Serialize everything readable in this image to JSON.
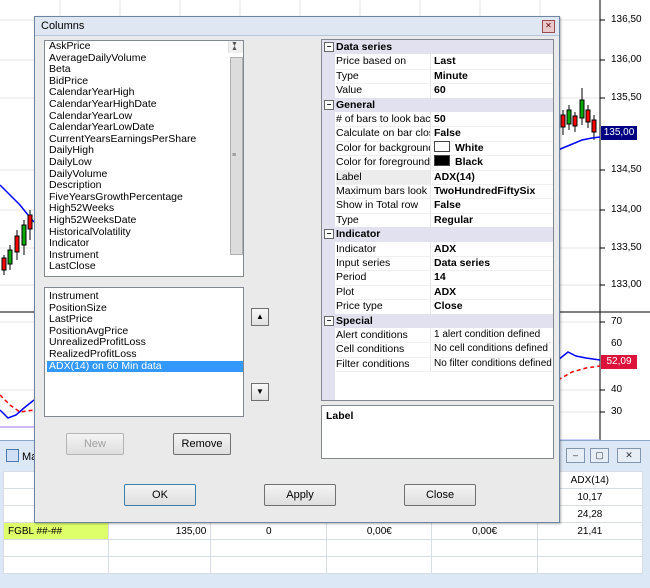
{
  "chart": {
    "y_axis_labels": [
      "136,50",
      "136,00",
      "135,50",
      "134,50",
      "134,00",
      "133,50",
      "133,00",
      "70",
      "60",
      "40",
      "30"
    ],
    "price_tag_main": "135,00",
    "price_tag_indicator": "52,09",
    "price_tag_main_color": "#000080",
    "price_tag_indicator_color": "#dc143c",
    "line_color": "#0000ff",
    "dash_color": "#ff0000"
  },
  "market_window": {
    "title": "Ma",
    "columns_partial": [
      "In",
      "ADX(14)"
    ],
    "rows": [
      {
        "instrument": "E",
        "adx": "10,17"
      },
      {
        "instrument": "FE",
        "adx": "24,28"
      },
      {
        "instrument": "FGBL ##-##",
        "price": "135,00",
        "position": "0",
        "pnl1": "0,00€",
        "pnl2": "0,00€",
        "adx": "21,41"
      }
    ]
  },
  "dialog": {
    "title": "Columns",
    "available_columns": [
      "AskPrice",
      "AverageDailyVolume",
      "Beta",
      "BidPrice",
      "CalendarYearHigh",
      "CalendarYearHighDate",
      "CalendarYearLow",
      "CalendarYearLowDate",
      "CurrentYearsEarningsPerShare",
      "DailyHigh",
      "DailyLow",
      "DailyVolume",
      "Description",
      "FiveYearsGrowthPercentage",
      "High52Weeks",
      "High52WeeksDate",
      "HistoricalVolatility",
      "Indicator",
      "Instrument",
      "LastClose"
    ],
    "selected_columns": [
      "Instrument",
      "PositionSize",
      "LastPrice",
      "PositionAvgPrice",
      "UnrealizedProfitLoss",
      "RealizedProfitLoss",
      "ADX(14) on 60 Min data"
    ],
    "buttons": {
      "new": "New",
      "remove": "Remove",
      "ok": "OK",
      "apply": "Apply",
      "close": "Close"
    },
    "properties": {
      "data_series": {
        "header": "Data series",
        "price_based_on": {
          "name": "Price based on",
          "value": "Last"
        },
        "type": {
          "name": "Type",
          "value": "Minute"
        },
        "value": {
          "name": "Value",
          "value": "60"
        }
      },
      "general": {
        "header": "General",
        "bars_to_look_back": {
          "name": "# of bars to look back",
          "value": "50"
        },
        "calculate_on_bar_close": {
          "name": "Calculate on bar close",
          "value": "False"
        },
        "color_background": {
          "name": "Color for background",
          "value": "White",
          "swatch": "#ffffff"
        },
        "color_foreground": {
          "name": "Color for foreground",
          "value": "Black",
          "swatch": "#000000"
        },
        "label": {
          "name": "Label",
          "value": "ADX(14)"
        },
        "max_bars_look_back": {
          "name": "Maximum bars look back",
          "value": "TwoHundredFiftySix"
        },
        "show_in_total_row": {
          "name": "Show in Total row",
          "value": "False"
        },
        "type": {
          "name": "Type",
          "value": "Regular"
        }
      },
      "indicator": {
        "header": "Indicator",
        "indicator": {
          "name": "Indicator",
          "value": "ADX"
        },
        "input_series": {
          "name": "Input series",
          "value": "Data series"
        },
        "period": {
          "name": "Period",
          "value": "14"
        },
        "plot": {
          "name": "Plot",
          "value": "ADX"
        },
        "price_type": {
          "name": "Price type",
          "value": "Close"
        }
      },
      "special": {
        "header": "Special",
        "alert_conditions": {
          "name": "Alert conditions",
          "value": "1 alert condition defined"
        },
        "cell_conditions": {
          "name": "Cell conditions",
          "value": "No cell conditions defined"
        },
        "filter_conditions": {
          "name": "Filter conditions",
          "value": "No filter conditions defined"
        }
      }
    },
    "description_title": "Label"
  },
  "icons": {
    "expander": "minus-box-icon",
    "up": "triangle-up-icon",
    "down": "triangle-down-icon",
    "close": "close-icon"
  }
}
